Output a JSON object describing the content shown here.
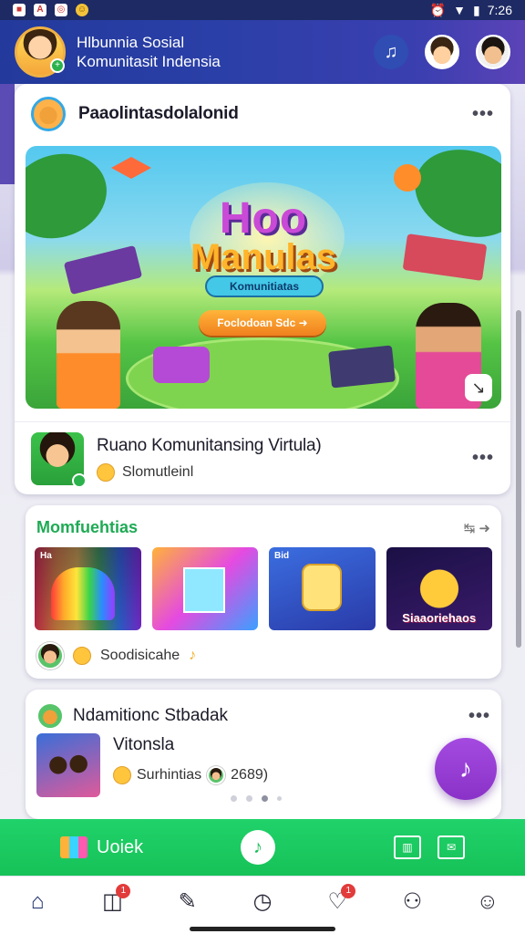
{
  "status": {
    "time": "7:26"
  },
  "header": {
    "title_line1": "Hlbunnia Sosial",
    "title_line2": "Komunitasit Indensia"
  },
  "post": {
    "title": "Paaolintasdolalonid",
    "more": "•••",
    "banner": {
      "logo_line1": "Hoo",
      "logo_line2": "Manulas",
      "pill": "Komunitiatas",
      "button": "Foclodoan Sdc ➜"
    },
    "community": {
      "title": "Ruano Komunitansing Virtula)",
      "subtitle": "Slomutleinl",
      "more": "•••"
    }
  },
  "section": {
    "title": "Momfuehtias",
    "thumb_labels": [
      "Ha",
      "",
      "Bid",
      "Siaaoriehaos"
    ],
    "footer_text": "Soodisicahe"
  },
  "featured": {
    "title": "Ndamitionc Stbadak",
    "more": "•••",
    "name": "Vitonsla",
    "meta_text": "Surhintias",
    "meta_count": "2689)"
  },
  "greenbar": {
    "label": "Uoiek"
  },
  "nav": {
    "items": [
      "home",
      "camera",
      "edit",
      "timer",
      "likes",
      "user-settings",
      "profile"
    ],
    "badge_camera": "1",
    "badge_likes": "1"
  }
}
